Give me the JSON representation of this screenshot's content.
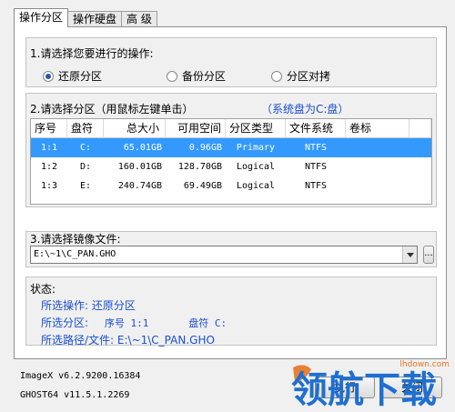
{
  "tabs": [
    "操作分区",
    "操作硬盘",
    "高 级"
  ],
  "operation": {
    "label": "1.请选择您要进行的操作:",
    "options": [
      {
        "label": "还原分区",
        "selected": true
      },
      {
        "label": "备份分区",
        "selected": false
      },
      {
        "label": "分区对拷",
        "selected": false
      }
    ]
  },
  "partition": {
    "label": "2.请选择分区（用鼠标左键单击）",
    "system_note": "（系统盘为C:盘）",
    "columns": [
      "序号",
      "盘符",
      "总大小",
      "可用空间",
      "分区类型",
      "文件系统",
      "卷标"
    ],
    "rows": [
      {
        "index": "1:1",
        "drive": "C:",
        "total": "65.01GB",
        "free": "0.96GB",
        "type": "Primary",
        "fs": "NTFS",
        "label": "",
        "selected": true
      },
      {
        "index": "1:2",
        "drive": "D:",
        "total": "160.01GB",
        "free": "128.70GB",
        "type": "Logical",
        "fs": "NTFS",
        "label": "",
        "selected": false
      },
      {
        "index": "1:3",
        "drive": "E:",
        "total": "240.74GB",
        "free": "69.49GB",
        "type": "Logical",
        "fs": "NTFS",
        "label": "",
        "selected": false
      }
    ]
  },
  "image": {
    "label": "3.请选择镜像文件:",
    "value": "E:\\~1\\C_PAN.GHO",
    "browse_label": "..."
  },
  "status": {
    "label": "状态:",
    "operation": "所选操作: 还原分区",
    "partition_prefix": "所选分区:",
    "partition_index": "序号 1:1",
    "partition_drive": "盘符 C:",
    "path": "所选路径/文件: E:\\~1\\C_PAN.GHO"
  },
  "footer": {
    "imagex": "ImageX v6.2.9200.16384",
    "ghost": "GHOST64 v11.5.1.2269"
  },
  "buttons": {
    "execute": "执行",
    "close": "关闭"
  },
  "watermark": {
    "text": "领航下载",
    "url": "lhdown.com"
  },
  "colors": {
    "selection": "#3399ff",
    "status_text": "#1a4fcf",
    "radio_dot": "#2456b5",
    "logo_blue": "#1f6fcf",
    "logo_orange": "#e8731f"
  }
}
